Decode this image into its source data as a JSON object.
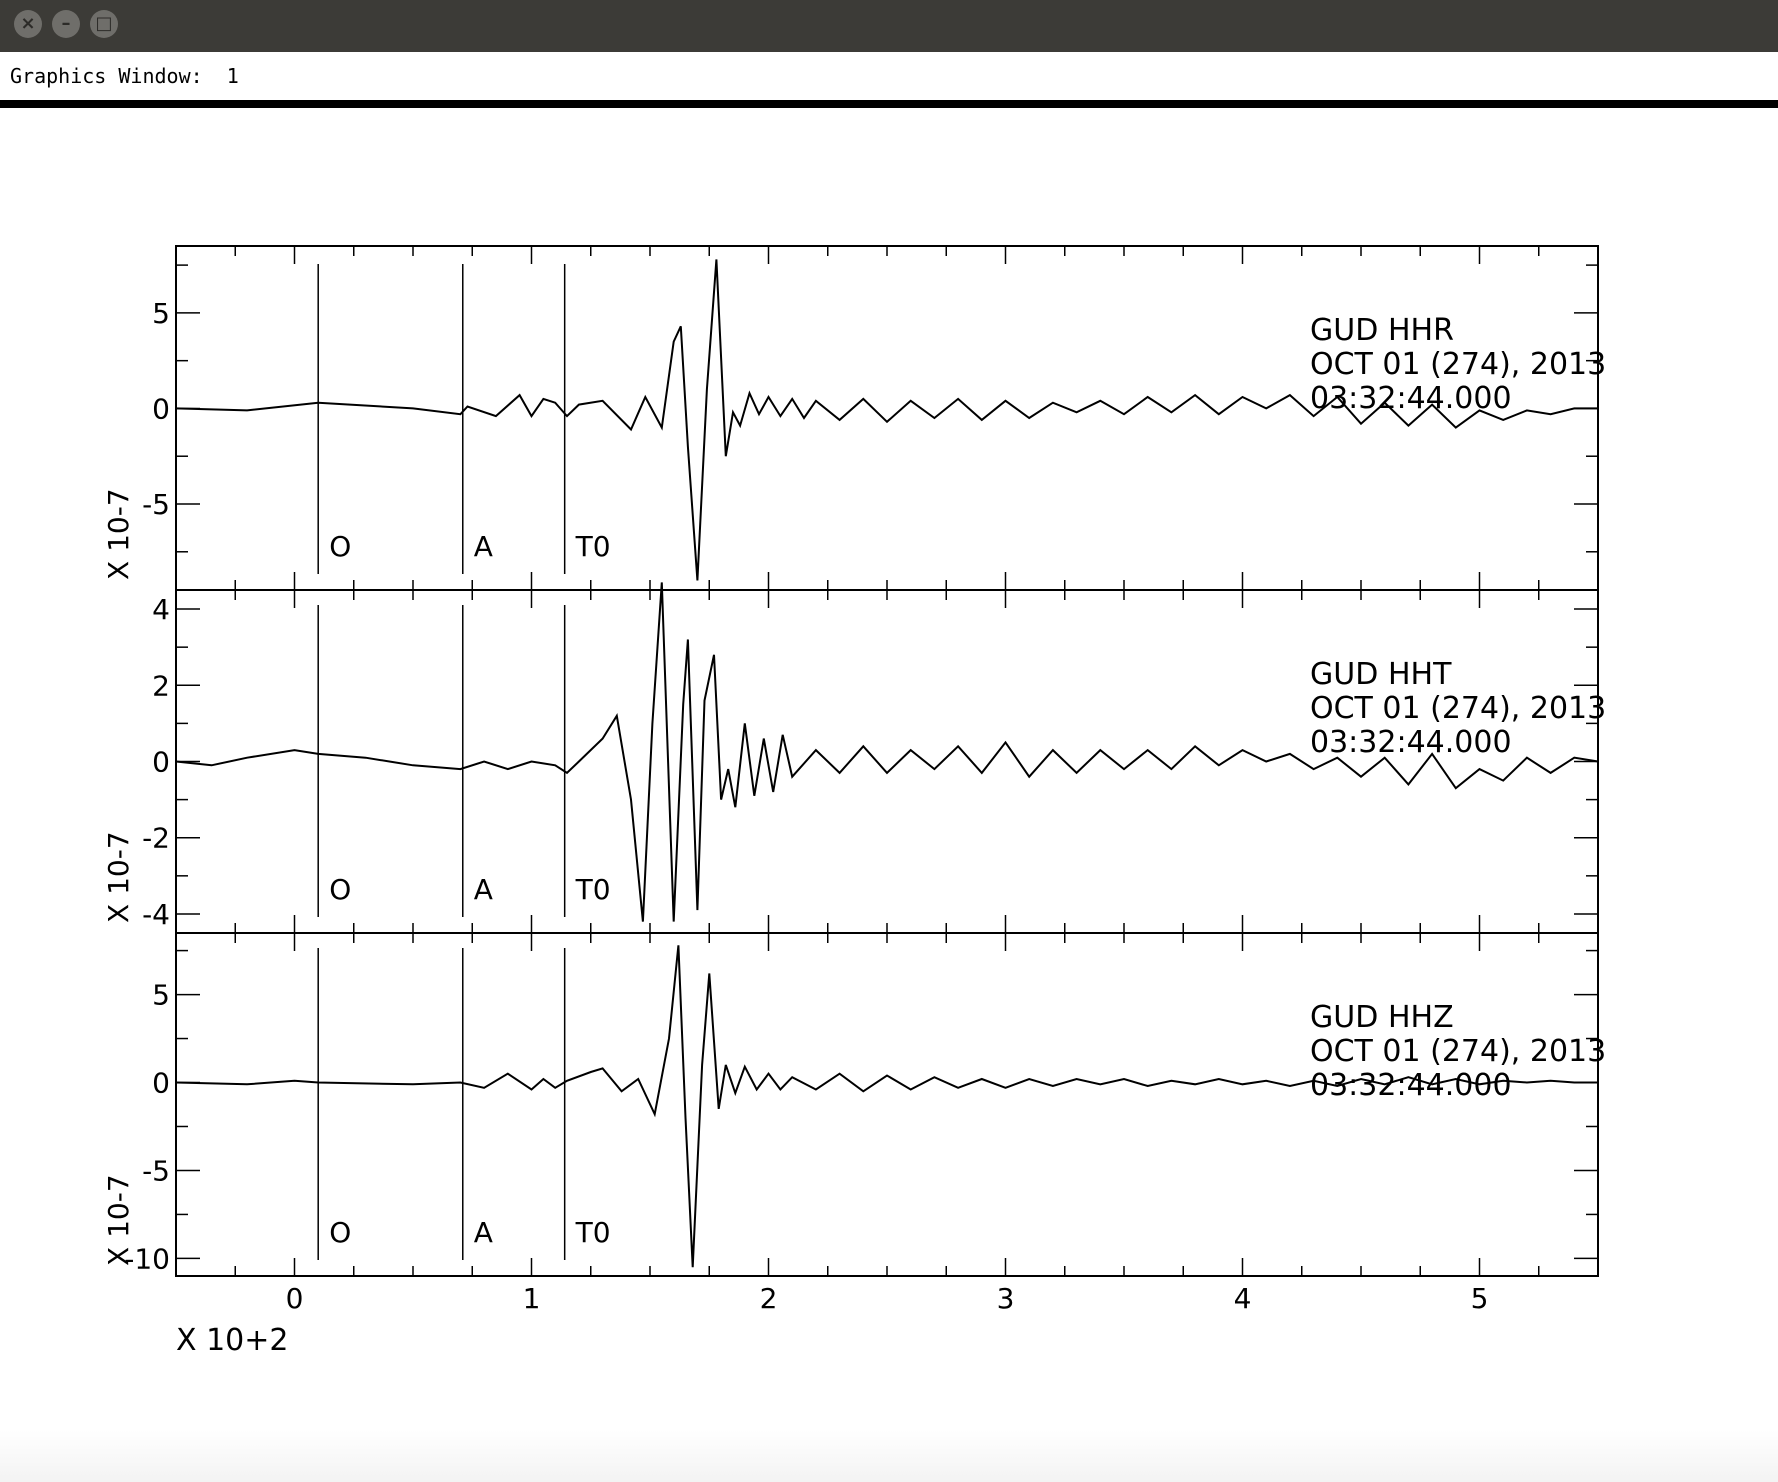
{
  "window": {
    "buttons": [
      "close-icon",
      "minimize-icon",
      "maximize-icon"
    ],
    "status_label": "Graphics Window:",
    "status_value": "1"
  },
  "chart_data": {
    "type": "line",
    "x_multiplier_label": "X 10+2",
    "xlim": [
      -0.5,
      5.5
    ],
    "xticks": [
      0,
      1,
      2,
      3,
      4,
      5
    ],
    "markers": [
      {
        "label": "O",
        "x": 0.1
      },
      {
        "label": "A",
        "x": 0.71
      },
      {
        "label": "T0",
        "x": 1.14
      }
    ],
    "panels": [
      {
        "station": "GUD",
        "channel": "HHR",
        "date": "OCT 01 (274), 2013",
        "time": "03:32:44.000",
        "y_multiplier_label": "X 10-7",
        "ylim": [
          -9.5,
          8.5
        ],
        "yticks": [
          -5,
          0,
          5
        ],
        "waveform": [
          [
            -0.5,
            0
          ],
          [
            -0.2,
            -0.1
          ],
          [
            0.1,
            0.3
          ],
          [
            0.5,
            0.0
          ],
          [
            0.7,
            -0.3
          ],
          [
            0.73,
            0.1
          ],
          [
            0.85,
            -0.4
          ],
          [
            0.95,
            0.7
          ],
          [
            1.0,
            -0.4
          ],
          [
            1.05,
            0.5
          ],
          [
            1.1,
            0.3
          ],
          [
            1.15,
            -0.4
          ],
          [
            1.2,
            0.2
          ],
          [
            1.3,
            0.4
          ],
          [
            1.42,
            -1.1
          ],
          [
            1.48,
            0.6
          ],
          [
            1.55,
            -1.0
          ],
          [
            1.6,
            3.5
          ],
          [
            1.63,
            4.3
          ],
          [
            1.66,
            -2.0
          ],
          [
            1.7,
            -9.0
          ],
          [
            1.74,
            1.0
          ],
          [
            1.78,
            7.8
          ],
          [
            1.82,
            -2.5
          ],
          [
            1.85,
            -0.2
          ],
          [
            1.88,
            -0.9
          ],
          [
            1.92,
            0.8
          ],
          [
            1.96,
            -0.3
          ],
          [
            2.0,
            0.6
          ],
          [
            2.05,
            -0.4
          ],
          [
            2.1,
            0.5
          ],
          [
            2.15,
            -0.5
          ],
          [
            2.2,
            0.4
          ],
          [
            2.3,
            -0.6
          ],
          [
            2.4,
            0.5
          ],
          [
            2.5,
            -0.7
          ],
          [
            2.6,
            0.4
          ],
          [
            2.7,
            -0.5
          ],
          [
            2.8,
            0.5
          ],
          [
            2.9,
            -0.6
          ],
          [
            3.0,
            0.4
          ],
          [
            3.1,
            -0.5
          ],
          [
            3.2,
            0.3
          ],
          [
            3.3,
            -0.2
          ],
          [
            3.4,
            0.4
          ],
          [
            3.5,
            -0.3
          ],
          [
            3.6,
            0.6
          ],
          [
            3.7,
            -0.2
          ],
          [
            3.8,
            0.7
          ],
          [
            3.9,
            -0.3
          ],
          [
            4.0,
            0.6
          ],
          [
            4.1,
            0.0
          ],
          [
            4.2,
            0.7
          ],
          [
            4.3,
            -0.4
          ],
          [
            4.4,
            0.6
          ],
          [
            4.5,
            -0.8
          ],
          [
            4.6,
            0.3
          ],
          [
            4.7,
            -0.9
          ],
          [
            4.8,
            0.2
          ],
          [
            4.9,
            -1.0
          ],
          [
            5.0,
            -0.1
          ],
          [
            5.1,
            -0.6
          ],
          [
            5.2,
            -0.1
          ],
          [
            5.3,
            -0.3
          ],
          [
            5.4,
            0.0
          ],
          [
            5.5,
            0.0
          ]
        ]
      },
      {
        "station": "GUD",
        "channel": "HHT",
        "date": "OCT 01 (274), 2013",
        "time": "03:32:44.000",
        "y_multiplier_label": "X 10-7",
        "ylim": [
          -4.5,
          4.5
        ],
        "yticks": [
          -4,
          -2,
          0,
          2,
          4
        ],
        "waveform": [
          [
            -0.5,
            0.0
          ],
          [
            -0.35,
            -0.1
          ],
          [
            -0.2,
            0.1
          ],
          [
            0.0,
            0.3
          ],
          [
            0.1,
            0.2
          ],
          [
            0.3,
            0.1
          ],
          [
            0.5,
            -0.1
          ],
          [
            0.7,
            -0.2
          ],
          [
            0.8,
            0.0
          ],
          [
            0.9,
            -0.2
          ],
          [
            1.0,
            0.0
          ],
          [
            1.1,
            -0.1
          ],
          [
            1.15,
            -0.3
          ],
          [
            1.2,
            0.0
          ],
          [
            1.3,
            0.6
          ],
          [
            1.36,
            1.2
          ],
          [
            1.42,
            -1.0
          ],
          [
            1.47,
            -4.2
          ],
          [
            1.51,
            1.0
          ],
          [
            1.55,
            4.7
          ],
          [
            1.6,
            -4.2
          ],
          [
            1.64,
            1.5
          ],
          [
            1.66,
            3.2
          ],
          [
            1.7,
            -3.9
          ],
          [
            1.73,
            1.6
          ],
          [
            1.77,
            2.8
          ],
          [
            1.8,
            -1.0
          ],
          [
            1.83,
            -0.2
          ],
          [
            1.86,
            -1.2
          ],
          [
            1.9,
            1.0
          ],
          [
            1.94,
            -0.9
          ],
          [
            1.98,
            0.6
          ],
          [
            2.02,
            -0.8
          ],
          [
            2.06,
            0.7
          ],
          [
            2.1,
            -0.4
          ],
          [
            2.2,
            0.3
          ],
          [
            2.3,
            -0.3
          ],
          [
            2.4,
            0.4
          ],
          [
            2.5,
            -0.3
          ],
          [
            2.6,
            0.3
          ],
          [
            2.7,
            -0.2
          ],
          [
            2.8,
            0.4
          ],
          [
            2.9,
            -0.3
          ],
          [
            3.0,
            0.5
          ],
          [
            3.1,
            -0.4
          ],
          [
            3.2,
            0.3
          ],
          [
            3.3,
            -0.3
          ],
          [
            3.4,
            0.3
          ],
          [
            3.5,
            -0.2
          ],
          [
            3.6,
            0.3
          ],
          [
            3.7,
            -0.2
          ],
          [
            3.8,
            0.4
          ],
          [
            3.9,
            -0.1
          ],
          [
            4.0,
            0.3
          ],
          [
            4.1,
            0.0
          ],
          [
            4.2,
            0.2
          ],
          [
            4.3,
            -0.2
          ],
          [
            4.4,
            0.1
          ],
          [
            4.5,
            -0.4
          ],
          [
            4.6,
            0.1
          ],
          [
            4.7,
            -0.6
          ],
          [
            4.8,
            0.2
          ],
          [
            4.9,
            -0.7
          ],
          [
            5.0,
            -0.2
          ],
          [
            5.1,
            -0.5
          ],
          [
            5.2,
            0.1
          ],
          [
            5.3,
            -0.3
          ],
          [
            5.4,
            0.1
          ],
          [
            5.5,
            0.0
          ]
        ]
      },
      {
        "station": "GUD",
        "channel": "HHZ",
        "date": "OCT 01 (274), 2013",
        "time": "03:32:44.000",
        "y_multiplier_label": "X 10-7",
        "ylim": [
          -11.0,
          8.5
        ],
        "yticks": [
          -10,
          -5,
          0,
          5
        ],
        "waveform": [
          [
            -0.5,
            0.0
          ],
          [
            -0.2,
            -0.1
          ],
          [
            0.0,
            0.1
          ],
          [
            0.1,
            0.0
          ],
          [
            0.5,
            -0.1
          ],
          [
            0.7,
            0.0
          ],
          [
            0.8,
            -0.3
          ],
          [
            0.9,
            0.5
          ],
          [
            1.0,
            -0.4
          ],
          [
            1.05,
            0.2
          ],
          [
            1.1,
            -0.3
          ],
          [
            1.15,
            0.1
          ],
          [
            1.25,
            0.6
          ],
          [
            1.3,
            0.8
          ],
          [
            1.38,
            -0.5
          ],
          [
            1.45,
            0.2
          ],
          [
            1.52,
            -1.8
          ],
          [
            1.58,
            2.5
          ],
          [
            1.62,
            7.8
          ],
          [
            1.65,
            -2.0
          ],
          [
            1.68,
            -10.5
          ],
          [
            1.72,
            1.0
          ],
          [
            1.75,
            6.2
          ],
          [
            1.79,
            -1.5
          ],
          [
            1.82,
            1.0
          ],
          [
            1.86,
            -0.6
          ],
          [
            1.9,
            0.9
          ],
          [
            1.95,
            -0.4
          ],
          [
            2.0,
            0.5
          ],
          [
            2.05,
            -0.4
          ],
          [
            2.1,
            0.3
          ],
          [
            2.2,
            -0.4
          ],
          [
            2.3,
            0.5
          ],
          [
            2.4,
            -0.5
          ],
          [
            2.5,
            0.4
          ],
          [
            2.6,
            -0.4
          ],
          [
            2.7,
            0.3
          ],
          [
            2.8,
            -0.3
          ],
          [
            2.9,
            0.2
          ],
          [
            3.0,
            -0.3
          ],
          [
            3.1,
            0.2
          ],
          [
            3.2,
            -0.2
          ],
          [
            3.3,
            0.2
          ],
          [
            3.4,
            -0.1
          ],
          [
            3.5,
            0.2
          ],
          [
            3.6,
            -0.2
          ],
          [
            3.7,
            0.1
          ],
          [
            3.8,
            -0.1
          ],
          [
            3.9,
            0.2
          ],
          [
            4.0,
            -0.1
          ],
          [
            4.1,
            0.1
          ],
          [
            4.2,
            -0.2
          ],
          [
            4.3,
            0.1
          ],
          [
            4.4,
            -0.2
          ],
          [
            4.5,
            0.2
          ],
          [
            4.6,
            -0.1
          ],
          [
            4.7,
            0.3
          ],
          [
            4.8,
            -0.1
          ],
          [
            4.9,
            0.2
          ],
          [
            5.0,
            -0.1
          ],
          [
            5.1,
            0.1
          ],
          [
            5.2,
            0.0
          ],
          [
            5.3,
            0.1
          ],
          [
            5.4,
            0.0
          ],
          [
            5.5,
            0.0
          ]
        ]
      }
    ]
  }
}
